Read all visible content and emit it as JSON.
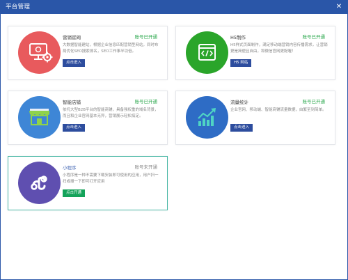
{
  "window": {
    "title": "平台管理",
    "close_glyph": "✕"
  },
  "cards": [
    {
      "name": "营销官网",
      "status": "账号已开通",
      "description": "大数据智能建站，根据企业信息匹配营销型网站，同时布局优化SEO搜索排名，SEO工作事半功倍。",
      "button": "点击进入",
      "icon": "website-settings-icon",
      "circle_color": "#e85a5d"
    },
    {
      "name": "H5制作",
      "status": "账号已开通",
      "description": "H5样式页面制作，满足移动端营销内容传播需求，让营销更是简便且自由，和微信官网更配喔！",
      "button": "H5 网站",
      "icon": "code-window-icon",
      "circle_color": "#2aa52a"
    },
    {
      "name": "智能店铺",
      "status": "账号已开通",
      "description": "依托大型B2B平台的智能商铺，具备强权重的域名背景，而且和企业官网基本无异，营销展示轻松搞定。",
      "button": "点击进入",
      "icon": "storefront-icon",
      "circle_color": "#3e86d6"
    },
    {
      "name": "流量统计",
      "status": "账号已开通",
      "description": "企业官网、移动端、智能商铺流量数据，由繁至到简单。",
      "button": "点击进入",
      "icon": "trend-chart-icon",
      "circle_color": "#2e6cc5"
    },
    {
      "name": "小程序",
      "status": "账号未开通",
      "description": "小程序是一种不需要下载安装即可使用的应用，用户扫一扫或搜一下即可打开应用",
      "button": "点击开通",
      "icon": "mini-program-icon",
      "circle_color": "#5f4fb0"
    }
  ]
}
